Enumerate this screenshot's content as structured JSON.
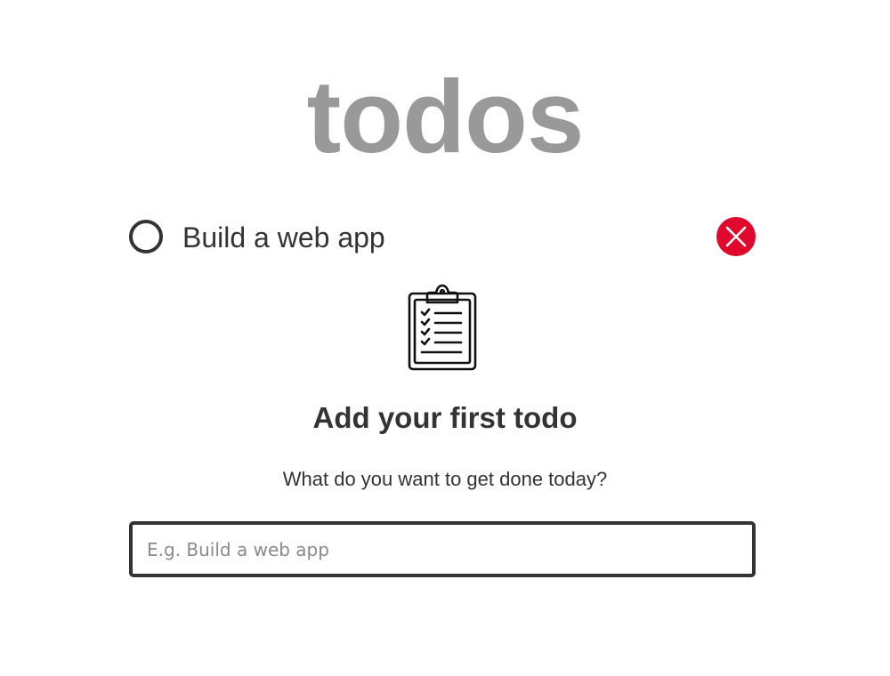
{
  "app": {
    "title": "todos"
  },
  "todos": [
    {
      "text": "Build a web app",
      "completed": false
    }
  ],
  "empty_state": {
    "icon": "clipboard-checklist-icon",
    "heading": "Add your first todo",
    "subheading": "What do you want to get done today?"
  },
  "input": {
    "value": "",
    "placeholder": "E.g. Build a web app"
  },
  "colors": {
    "title": "#999999",
    "text": "#333333",
    "delete": "#e0082d",
    "background": "#ffffff"
  }
}
